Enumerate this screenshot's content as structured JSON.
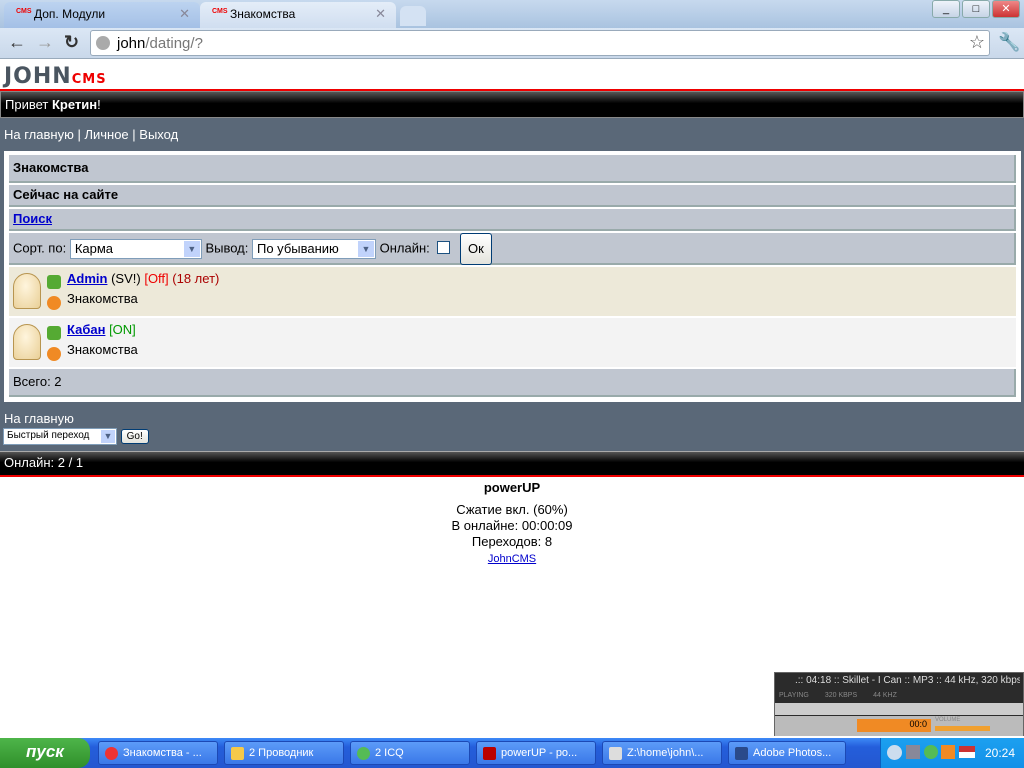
{
  "browser": {
    "tabs": [
      {
        "title": "Доп. Модули",
        "favicon": "CMS"
      },
      {
        "title": "Знакомства",
        "favicon": "CMS"
      }
    ],
    "url_host": "john",
    "url_path": "/dating/?"
  },
  "site": {
    "logo": "JOHN",
    "logo_sub": "CMS",
    "greeting": "Привет ",
    "username": "Кретин",
    "greeting_end": "!",
    "nav": [
      "На главную",
      "Личное",
      "Выход"
    ],
    "nav_sep": " | "
  },
  "main": {
    "title": "Знакомства",
    "subtitle": "Сейчас на сайте",
    "search_link": "Поиск",
    "sort_label": "Сорт. по:",
    "sort_value": "Карма",
    "output_label": "Вывод:",
    "output_value": "По убыванию",
    "online_label": "Онлайн:",
    "online_checked": false,
    "ok_label": "Ок",
    "users": [
      {
        "name": "Admin",
        "tag": "(SV!)",
        "status": "[Off]",
        "age": "(18 лет)",
        "location": "Знакомства"
      },
      {
        "name": "Кабан",
        "status": "[ON]",
        "location": "Знакомства"
      }
    ],
    "total": "Всего: 2"
  },
  "bottom": {
    "home_link": "На главную",
    "quick_jump": "Быстрый переход",
    "go_label": "Go!",
    "online": "Онлайн: 2 / 1"
  },
  "footer": {
    "title": "powerUP",
    "compression": "Сжатие вкл. (60%)",
    "online_time": "В онлайне: 00:00:09",
    "transitions": "Переходов: 8",
    "link": "JohnCMS"
  },
  "winamp": {
    "ticker": ".:: 04:18 :: Skillet - I Can :: MP3 :: 44 kHz, 320 kbps",
    "state": "PLAYING",
    "kbps": "320 KBPS",
    "khz": "44 KHZ",
    "time": "00:0",
    "volume_label": "VOLUME"
  },
  "taskbar": {
    "start": "пуск",
    "tasks": [
      {
        "label": "Знакомства - ...",
        "color": "#e33"
      },
      {
        "label": "2 Проводник",
        "color": "#f5c94a"
      },
      {
        "label": "2 ICQ",
        "color": "#5b5"
      },
      {
        "label": "powerUP - po...",
        "color": "#b00"
      },
      {
        "label": "Z:\\home\\john\\...",
        "color": "#ddd"
      },
      {
        "label": "Adobe Photos...",
        "color": "#2a4a8a"
      }
    ],
    "clock": "20:24"
  }
}
